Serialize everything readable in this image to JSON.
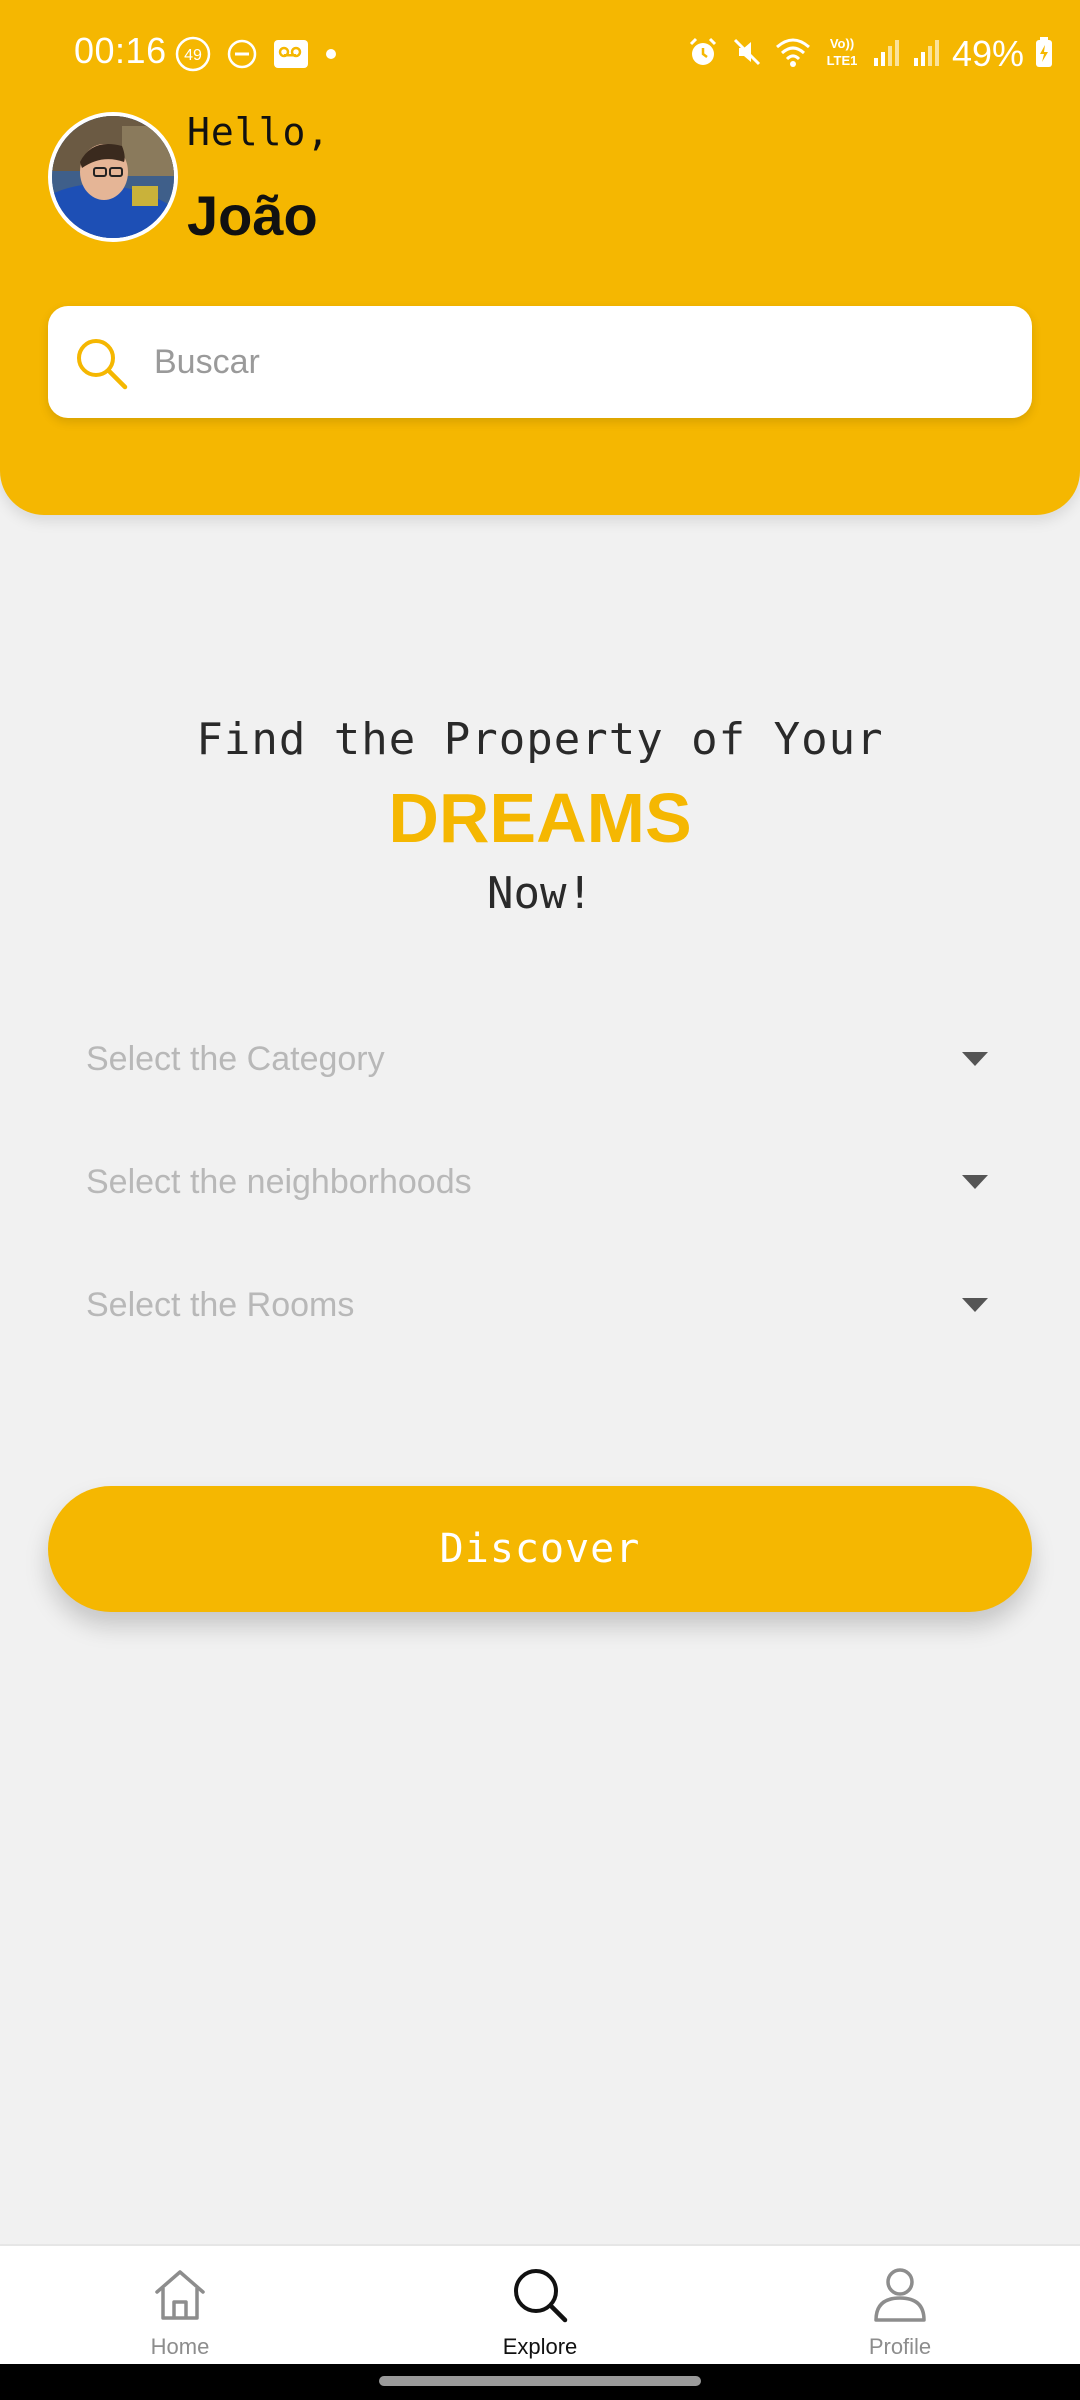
{
  "status_bar": {
    "time": "00:16",
    "notification_badge": "49",
    "battery": "49%",
    "network_label_top": "Vo))",
    "network_label_bottom": "LTE1"
  },
  "header": {
    "greeting": "Hello,",
    "user_name": "João",
    "avatar_alt": "User avatar"
  },
  "search": {
    "placeholder": "Buscar",
    "value": ""
  },
  "hero": {
    "line1": "Find the Property of Your",
    "highlight": "DREAMS",
    "line3": "Now!"
  },
  "filters": {
    "category": "Select the Category",
    "neighborhoods": "Select the neighborhoods",
    "rooms": "Select the Rooms"
  },
  "actions": {
    "discover_label": "Discover"
  },
  "bottom_nav": {
    "items": [
      {
        "label": "Home",
        "icon": "home-icon",
        "active": false
      },
      {
        "label": "Explore",
        "icon": "search-icon",
        "active": true
      },
      {
        "label": "Profile",
        "icon": "person-icon",
        "active": false
      }
    ]
  },
  "colors": {
    "accent": "#f5b701",
    "background": "#f1f1f1",
    "placeholder_text": "#b8b8b8"
  }
}
